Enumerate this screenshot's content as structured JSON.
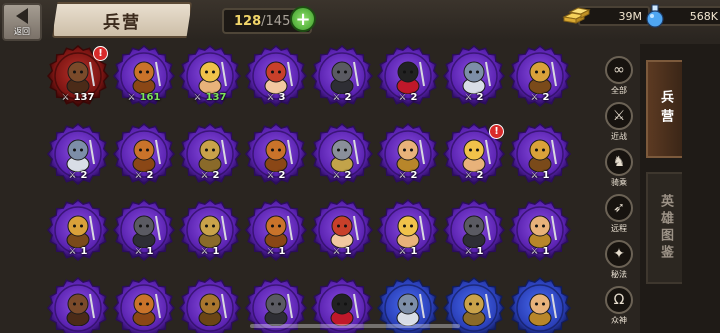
{
  "header": {
    "back_label": "返回",
    "title": "兵营",
    "unit_count": "128",
    "unit_separator": "/",
    "unit_capacity": "145",
    "add_icon": "plus-icon",
    "gold": "39M",
    "gems": "568K"
  },
  "colors": {
    "badge_purple": "#6b2fc4",
    "badge_dark": "#3a1570",
    "badge_red": "#8c1a18",
    "badge_blue": "#2a45c9",
    "count_green": "#7de45a",
    "alert_red": "#d82a2a",
    "gold_text": "#f1d56a"
  },
  "units": [
    {
      "row": 0,
      "col": 0,
      "count": "137",
      "style": "red",
      "face": "boar",
      "alert": true,
      "green": false
    },
    {
      "row": 0,
      "col": 1,
      "count": "161",
      "style": "purple",
      "face": "monkey",
      "alert": false,
      "green": true
    },
    {
      "row": 0,
      "col": 2,
      "count": "137",
      "style": "purple",
      "face": "king",
      "alert": false,
      "green": true
    },
    {
      "row": 0,
      "col": 3,
      "count": "3",
      "style": "purple",
      "face": "redhair",
      "alert": false,
      "green": false
    },
    {
      "row": 0,
      "col": 4,
      "count": "2",
      "style": "purple",
      "face": "helmet-dark",
      "alert": false,
      "green": false
    },
    {
      "row": 0,
      "col": 5,
      "count": "2",
      "style": "purple",
      "face": "ninja",
      "alert": false,
      "green": false
    },
    {
      "row": 0,
      "col": 6,
      "count": "2",
      "style": "purple",
      "face": "wolf",
      "alert": false,
      "green": false
    },
    {
      "row": 0,
      "col": 7,
      "count": "2",
      "style": "purple",
      "face": "gold-helmet",
      "alert": false,
      "green": false
    },
    {
      "row": 1,
      "col": 0,
      "count": "2",
      "style": "purple",
      "face": "wolf",
      "alert": false,
      "green": false
    },
    {
      "row": 1,
      "col": 1,
      "count": "2",
      "style": "purple",
      "face": "monkey",
      "alert": false,
      "green": false
    },
    {
      "row": 1,
      "col": 2,
      "count": "2",
      "style": "purple",
      "face": "knight",
      "alert": false,
      "green": false
    },
    {
      "row": 1,
      "col": 3,
      "count": "2",
      "style": "purple",
      "face": "monkey",
      "alert": false,
      "green": false
    },
    {
      "row": 1,
      "col": 4,
      "count": "2",
      "style": "purple",
      "face": "shield",
      "alert": false,
      "green": false
    },
    {
      "row": 1,
      "col": 5,
      "count": "2",
      "style": "purple",
      "face": "warrior",
      "alert": false,
      "green": false
    },
    {
      "row": 1,
      "col": 6,
      "count": "2",
      "style": "purple",
      "face": "king",
      "alert": true,
      "green": false
    },
    {
      "row": 1,
      "col": 7,
      "count": "1",
      "style": "purple",
      "face": "gold-helmet",
      "alert": false,
      "green": false
    },
    {
      "row": 2,
      "col": 0,
      "count": "1",
      "style": "purple",
      "face": "gold-helmet",
      "alert": false,
      "green": false
    },
    {
      "row": 2,
      "col": 1,
      "count": "1",
      "style": "purple",
      "face": "helmet-dark",
      "alert": false,
      "green": false
    },
    {
      "row": 2,
      "col": 2,
      "count": "1",
      "style": "purple",
      "face": "knight",
      "alert": false,
      "green": false
    },
    {
      "row": 2,
      "col": 3,
      "count": "1",
      "style": "purple",
      "face": "monkey",
      "alert": false,
      "green": false
    },
    {
      "row": 2,
      "col": 4,
      "count": "1",
      "style": "purple",
      "face": "redhair",
      "alert": false,
      "green": false
    },
    {
      "row": 2,
      "col": 5,
      "count": "1",
      "style": "purple",
      "face": "king",
      "alert": false,
      "green": false
    },
    {
      "row": 2,
      "col": 6,
      "count": "1",
      "style": "purple",
      "face": "helmet-dark",
      "alert": false,
      "green": false
    },
    {
      "row": 2,
      "col": 7,
      "count": "1",
      "style": "purple",
      "face": "warrior",
      "alert": false,
      "green": false
    },
    {
      "row": 3,
      "col": 0,
      "count": "",
      "style": "purple",
      "face": "boar",
      "alert": false,
      "green": false
    },
    {
      "row": 3,
      "col": 1,
      "count": "",
      "style": "purple",
      "face": "monkey",
      "alert": false,
      "green": false
    },
    {
      "row": 3,
      "col": 2,
      "count": "",
      "style": "purple",
      "face": "lion",
      "alert": false,
      "green": false
    },
    {
      "row": 3,
      "col": 3,
      "count": "",
      "style": "purple",
      "face": "helmet-dark",
      "alert": false,
      "green": false
    },
    {
      "row": 3,
      "col": 4,
      "count": "",
      "style": "purple",
      "face": "ninja",
      "alert": false,
      "green": false
    },
    {
      "row": 3,
      "col": 5,
      "count": "",
      "style": "blue",
      "face": "wolf",
      "alert": false,
      "green": false
    },
    {
      "row": 3,
      "col": 6,
      "count": "",
      "style": "blue",
      "face": "knight",
      "alert": false,
      "green": false
    },
    {
      "row": 3,
      "col": 7,
      "count": "",
      "style": "blue",
      "face": "warrior",
      "alert": false,
      "green": false
    }
  ],
  "filters": [
    {
      "label": "全部",
      "icon": "infinity-icon",
      "glyph": "∞"
    },
    {
      "label": "近战",
      "icon": "sword-icon",
      "glyph": "⚔"
    },
    {
      "label": "骑乘",
      "icon": "horse-icon",
      "glyph": "♞"
    },
    {
      "label": "远程",
      "icon": "bow-icon",
      "glyph": "➶"
    },
    {
      "label": "秘法",
      "icon": "magic-icon",
      "glyph": "✦"
    },
    {
      "label": "众神",
      "icon": "omega-icon",
      "glyph": "Ω"
    }
  ],
  "tabs": {
    "barracks": "兵营",
    "codex": "英雄图鉴"
  }
}
